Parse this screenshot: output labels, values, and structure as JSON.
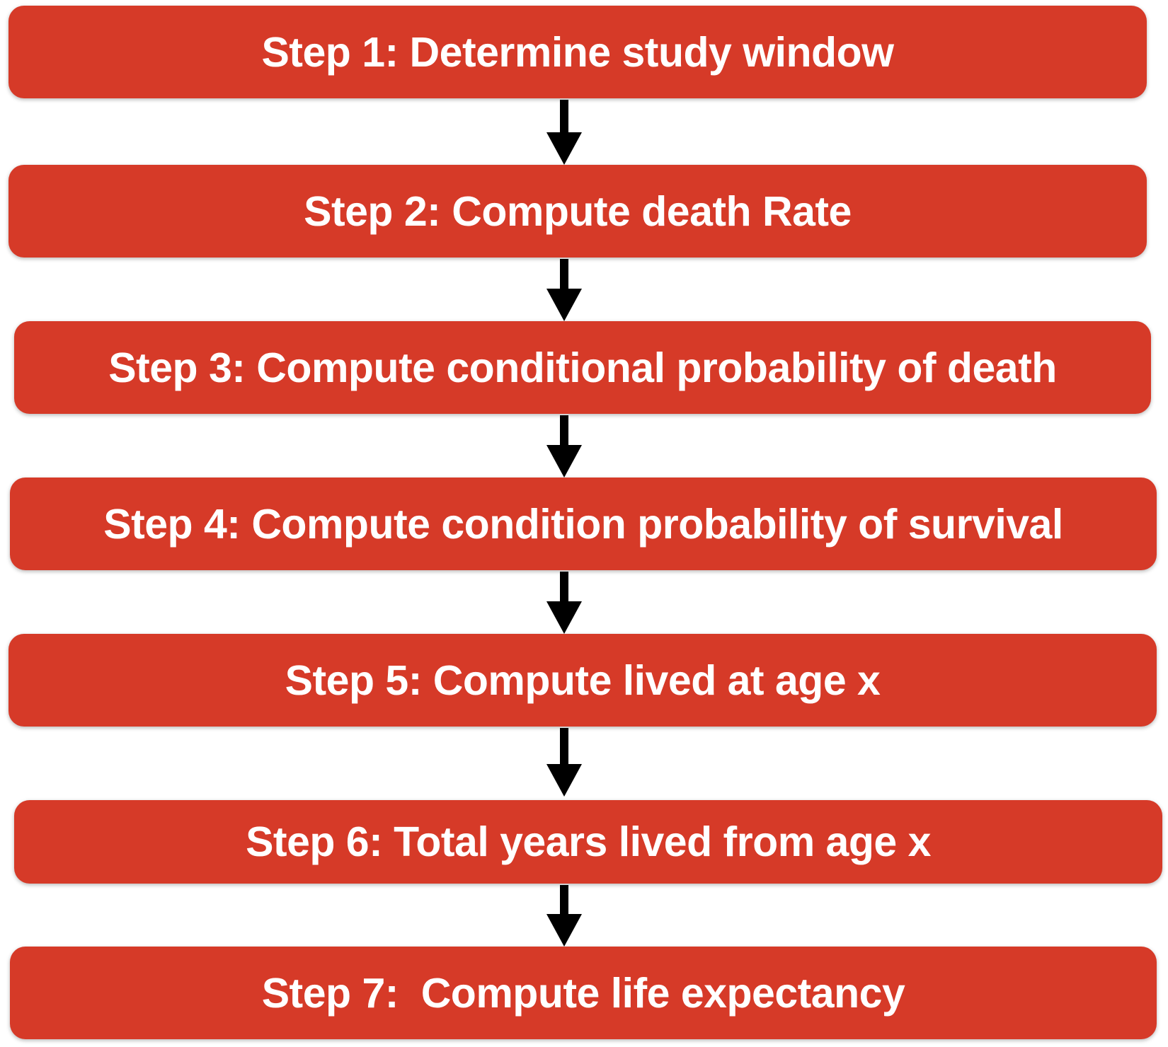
{
  "diagram": {
    "steps": [
      {
        "label": "Step 1: Determine study window"
      },
      {
        "label": "Step 2: Compute death Rate"
      },
      {
        "label": "Step 3: Compute conditional probability of death"
      },
      {
        "label": "Step 4: Compute condition probability of survival"
      },
      {
        "label": "Step 5: Compute lived at age x"
      },
      {
        "label": "Step 6: Total years lived from age x"
      },
      {
        "label": "Step 7:  Compute life expectancy"
      }
    ],
    "colors": {
      "box_fill": "#d63a28",
      "box_text": "#ffffff",
      "arrow": "#000000"
    }
  }
}
